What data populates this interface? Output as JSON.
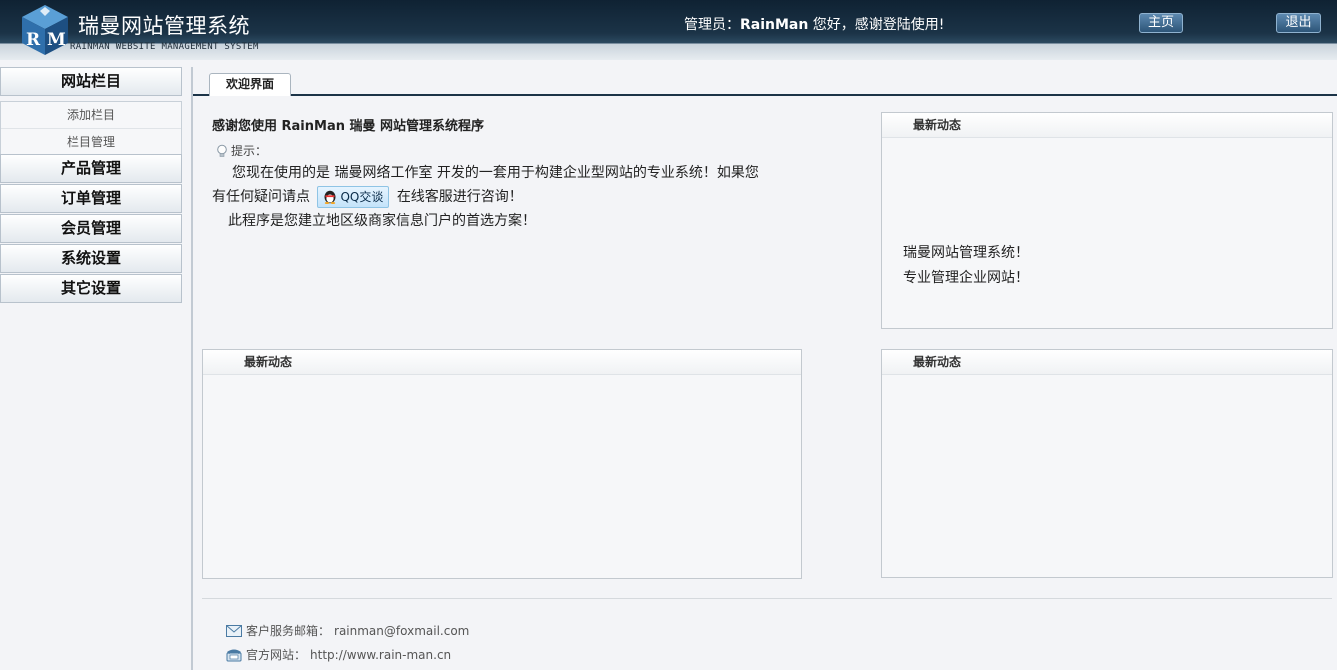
{
  "header": {
    "logo_text": "RM",
    "title": "瑞曼网站管理系统",
    "subtitle": "RAINMAN WEBSITE MANAGEMENT SYSTEM",
    "greeting_prefix": "管理员：",
    "greeting_user": "RainMan",
    "greeting_suffix": " 您好，感谢登陆使用!",
    "home_button": "主页",
    "logout_button": "退出"
  },
  "sidebar": {
    "categories": [
      {
        "label": "网站栏目",
        "subitems": [
          "添加栏目",
          "栏目管理"
        ]
      },
      {
        "label": "产品管理"
      },
      {
        "label": "订单管理"
      },
      {
        "label": "会员管理"
      },
      {
        "label": "系统设置"
      },
      {
        "label": "其它设置"
      }
    ]
  },
  "tabs": {
    "active": "欢迎界面"
  },
  "welcome": {
    "title": "感谢您使用 RainMan 瑞曼 网站管理系统程序",
    "tip_label": "提示：",
    "line1": "您现在使用的是 瑞曼网络工作室 开发的一套用于构建企业型网站的专业系统！如果您",
    "line2_before": "有任何疑问请点",
    "qq_button": "QQ交谈",
    "line2_after": "在线客服进行咨询！",
    "line3": "此程序是您建立地区级商家信息门户的首选方案！"
  },
  "panels": {
    "p1": {
      "title": "最新动态",
      "lines": [
        "瑞曼网站管理系统！",
        "专业管理企业网站！"
      ]
    },
    "p2": {
      "title": "最新动态"
    },
    "p3": {
      "title": "最新动态"
    }
  },
  "footer": {
    "email_label": "客户服务邮箱：",
    "email": "rainman@foxmail.com",
    "site_label": "官方网站：",
    "site": "http://www.rain-man.cn"
  },
  "icons": {
    "logo": "rm-cube-logo",
    "tip": "lightbulb-icon",
    "qq": "qq-penguin-icon",
    "mail": "mail-icon",
    "phone": "phone-icon"
  }
}
